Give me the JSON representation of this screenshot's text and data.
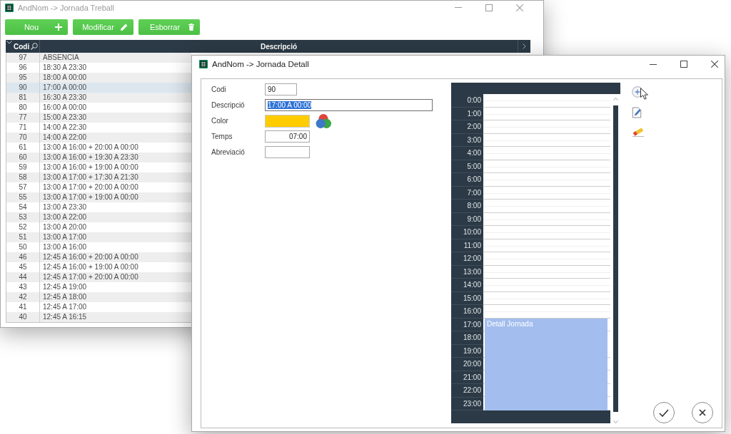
{
  "app_window": {
    "title": "AndNom -> Jornada Treball",
    "active": false,
    "toolbar": [
      {
        "label": "Nou",
        "kind": "add"
      },
      {
        "label": "Modificar",
        "kind": "edit"
      },
      {
        "label": "Esborrar",
        "kind": "delete"
      }
    ],
    "table": {
      "columns": [
        "Codi",
        "Descripció"
      ],
      "rows": [
        {
          "cells": [
            "97",
            "ABSENCIA"
          ],
          "selected": false
        },
        {
          "cells": [
            "96",
            "18:30 A 23:30"
          ],
          "selected": false
        },
        {
          "cells": [
            "95",
            "18:00 A 00:00"
          ],
          "selected": false
        },
        {
          "cells": [
            "90",
            "17:00 A 00:00"
          ],
          "selected": true
        },
        {
          "cells": [
            "81",
            "16:30 A 23:30"
          ],
          "selected": false
        },
        {
          "cells": [
            "80",
            "16:00 A 00:00"
          ],
          "selected": false
        },
        {
          "cells": [
            "77",
            "15:00 A 23:30"
          ],
          "selected": false
        },
        {
          "cells": [
            "71",
            "14:00 A 22:30"
          ],
          "selected": false
        },
        {
          "cells": [
            "70",
            "14:00 A 22:00"
          ],
          "selected": false
        },
        {
          "cells": [
            "61",
            "13:00 A 16:00 + 20:00 A 00:00"
          ],
          "selected": false
        },
        {
          "cells": [
            "60",
            "13:00 A 16:00 + 19:30 A 23:30"
          ],
          "selected": false
        },
        {
          "cells": [
            "59",
            "13:00 A 16:00 + 19:00 A 00:00"
          ],
          "selected": false
        },
        {
          "cells": [
            "58",
            "13:00 A 17:00 + 17:30 A 21:30"
          ],
          "selected": false
        },
        {
          "cells": [
            "57",
            "13:00 A 17:00 + 20:00 A 00:00"
          ],
          "selected": false
        },
        {
          "cells": [
            "55",
            "13:00 A 17:00 + 19:00 A 00:00"
          ],
          "selected": false
        },
        {
          "cells": [
            "54",
            "13:00 A 23:30"
          ],
          "selected": false
        },
        {
          "cells": [
            "53",
            "13:00 A 22:00"
          ],
          "selected": false
        },
        {
          "cells": [
            "52",
            "13:00 A 20:00"
          ],
          "selected": false
        },
        {
          "cells": [
            "51",
            "13:00 A 17:00"
          ],
          "selected": false
        },
        {
          "cells": [
            "50",
            "13:00 A 16:00"
          ],
          "selected": false
        },
        {
          "cells": [
            "46",
            "12:45 A 16:00 + 20:00 A 00:00"
          ],
          "selected": false
        },
        {
          "cells": [
            "45",
            "12:45 A 16:00 + 19:00 A 00:00"
          ],
          "selected": false
        },
        {
          "cells": [
            "44",
            "12:45 A 17:00 + 20:00 A 00:00"
          ],
          "selected": false
        },
        {
          "cells": [
            "43",
            "12:45 A 19:00"
          ],
          "selected": false
        },
        {
          "cells": [
            "42",
            "12:45 A 18:00"
          ],
          "selected": false
        },
        {
          "cells": [
            "41",
            "12:45 A 17:00"
          ],
          "selected": false
        },
        {
          "cells": [
            "40",
            "12:45 A 16:15"
          ],
          "selected": false
        }
      ]
    }
  },
  "detail_window": {
    "title": "AndNom -> Jornada Detall",
    "active": true,
    "form": [
      {
        "label": "Codi",
        "kind": "text",
        "value": "90",
        "text_selected": false
      },
      {
        "label": "Descripció",
        "kind": "text",
        "value": "17:00 A 00:00",
        "text_selected": true
      },
      {
        "label": "Color",
        "kind": "color",
        "color": "#ffcc00"
      },
      {
        "label": "Temps",
        "kind": "time",
        "value": "07:00",
        "text_selected": false
      },
      {
        "label": "Abreviació",
        "kind": "text"
      }
    ],
    "calendar": {
      "hours": [
        {
          "label": "0:00",
          "busy": false
        },
        {
          "label": "1:00",
          "busy": false
        },
        {
          "label": "2:00",
          "busy": false
        },
        {
          "label": "3:00",
          "busy": false
        },
        {
          "label": "4:00",
          "busy": false
        },
        {
          "label": "5:00",
          "busy": false
        },
        {
          "label": "6:00",
          "busy": false
        },
        {
          "label": "7:00",
          "busy": false
        },
        {
          "label": "8:00",
          "busy": false
        },
        {
          "label": "9:00",
          "busy": false
        },
        {
          "label": "10:00",
          "busy": false
        },
        {
          "label": "11:00",
          "busy": false
        },
        {
          "label": "12:00",
          "busy": false
        },
        {
          "label": "13:00",
          "busy": false
        },
        {
          "label": "14:00",
          "busy": false
        },
        {
          "label": "15:00",
          "busy": false
        },
        {
          "label": "16:00",
          "busy": false
        },
        {
          "label": "17:00",
          "busy": true
        },
        {
          "label": "18:00",
          "busy": true
        },
        {
          "label": "19:00",
          "busy": true
        },
        {
          "label": "20:00",
          "busy": true
        },
        {
          "label": "21:00",
          "busy": true
        },
        {
          "label": "22:00",
          "busy": true
        },
        {
          "label": "23:00",
          "busy": true
        }
      ],
      "event_title": "Detall Jornada"
    }
  }
}
